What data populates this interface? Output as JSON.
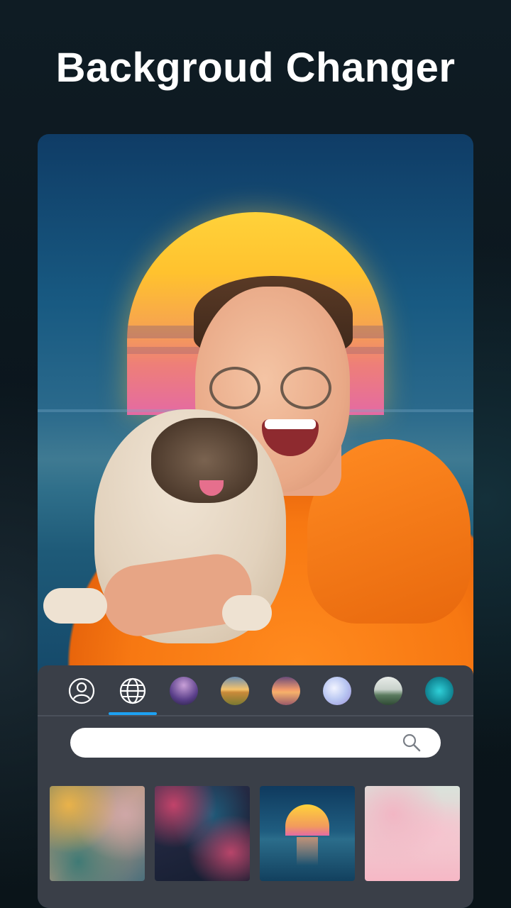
{
  "headline": "Backgroud Changer",
  "editor": {
    "tabs": [
      {
        "name": "person-icon",
        "active": false
      },
      {
        "name": "globe-icon",
        "active": true
      },
      {
        "name": "night-couple-thumb",
        "active": false
      },
      {
        "name": "sunset-field-thumb",
        "active": false
      },
      {
        "name": "sunset-sea-thumb",
        "active": false
      },
      {
        "name": "crystal-pattern-thumb",
        "active": false
      },
      {
        "name": "misty-hills-thumb",
        "active": false
      },
      {
        "name": "teal-sparkle-thumb",
        "active": false
      }
    ],
    "accent_color": "#1da1f2",
    "search": {
      "value": "",
      "placeholder": "",
      "icon": "search-icon"
    },
    "backgrounds": [
      {
        "name": "marble-texture"
      },
      {
        "name": "tropical-leaves"
      },
      {
        "name": "sunset-ocean"
      },
      {
        "name": "pink-clouds"
      }
    ]
  }
}
